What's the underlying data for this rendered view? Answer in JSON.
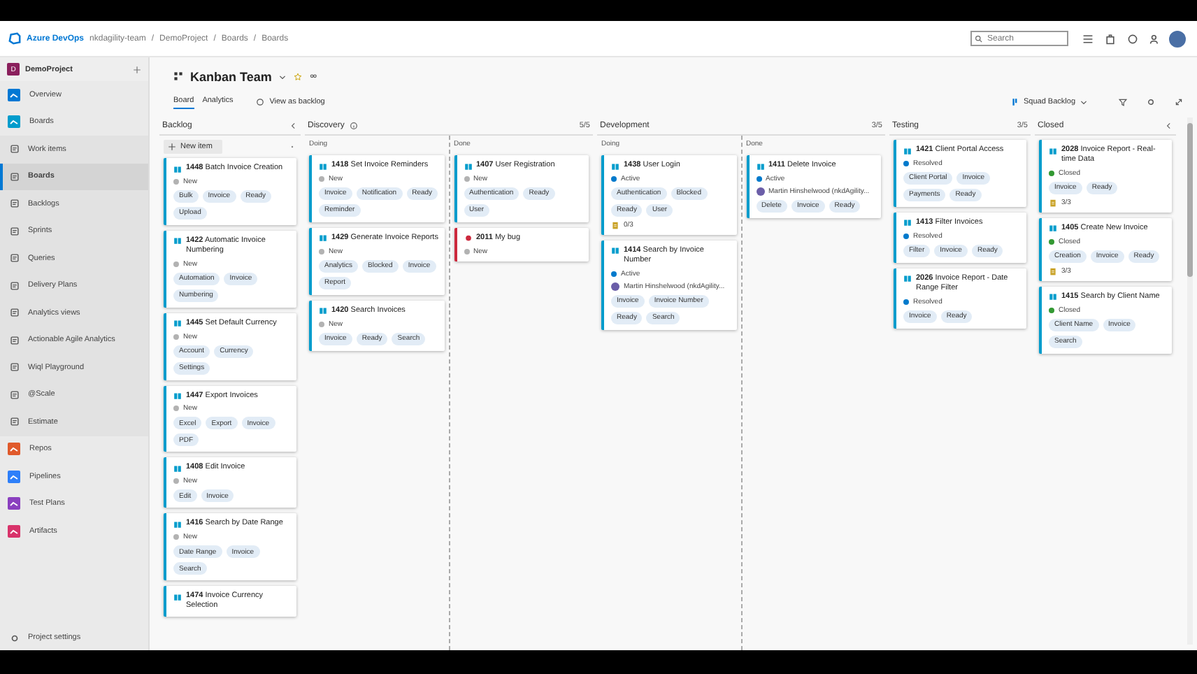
{
  "header": {
    "brand": "Azure DevOps",
    "breadcrumbs": [
      "nkdagility-team",
      "DemoProject",
      "Boards",
      "Boards"
    ],
    "separator": "/",
    "search": {
      "placeholder": "Search"
    }
  },
  "sidebar": {
    "project": {
      "initial": "D",
      "name": "DemoProject"
    },
    "items": [
      {
        "label": "Overview",
        "kind": "service",
        "selected": false
      },
      {
        "label": "Boards",
        "kind": "service",
        "selected": false
      },
      {
        "label": "Work items",
        "kind": "page",
        "selected": false
      },
      {
        "label": "Boards",
        "kind": "page",
        "selected": true
      },
      {
        "label": "Backlogs",
        "kind": "page",
        "selected": false
      },
      {
        "label": "Sprints",
        "kind": "page",
        "selected": false
      },
      {
        "label": "Queries",
        "kind": "page",
        "selected": false
      },
      {
        "label": "Delivery Plans",
        "kind": "page",
        "selected": false
      },
      {
        "label": "Analytics views",
        "kind": "page",
        "selected": false
      },
      {
        "label": "Actionable Agile Analytics",
        "kind": "page",
        "selected": false
      },
      {
        "label": "Wiql Playground",
        "kind": "page",
        "selected": false
      },
      {
        "label": "@Scale",
        "kind": "page",
        "selected": false
      },
      {
        "label": "Estimate",
        "kind": "page",
        "selected": false
      },
      {
        "label": "Repos",
        "kind": "service",
        "selected": false
      },
      {
        "label": "Pipelines",
        "kind": "service",
        "selected": false
      },
      {
        "label": "Test Plans",
        "kind": "service",
        "selected": false
      },
      {
        "label": "Artifacts",
        "kind": "service",
        "selected": false
      }
    ],
    "settings": "Project settings"
  },
  "board_header": {
    "title": "Kanban Team",
    "tabs": [
      {
        "label": "Board",
        "selected": true
      },
      {
        "label": "Analytics",
        "selected": false
      }
    ],
    "view_link": "View as backlog",
    "backlog_picker": "Squad Backlog"
  },
  "columns": [
    {
      "name": "Backlog",
      "collapse": true,
      "new_item": "New item",
      "lanes": [
        {
          "cards": [
            {
              "kind": "story",
              "id": "1448",
              "title": "Batch Invoice Creation",
              "state": "New",
              "color": "#b2b2b2",
              "tags": [
                "Bulk",
                "Invoice",
                "Ready",
                "Upload"
              ]
            },
            {
              "kind": "story",
              "id": "1422",
              "title": "Automatic Invoice Numbering",
              "state": "New",
              "color": "#b2b2b2",
              "tags": [
                "Automation",
                "Invoice",
                "Numbering"
              ]
            },
            {
              "kind": "story",
              "id": "1445",
              "title": "Set Default Currency",
              "state": "New",
              "color": "#b2b2b2",
              "tags": [
                "Account",
                "Currency",
                "Settings"
              ]
            },
            {
              "kind": "story",
              "id": "1447",
              "title": "Export Invoices",
              "state": "New",
              "color": "#b2b2b2",
              "tags": [
                "Excel",
                "Export",
                "Invoice",
                "PDF"
              ]
            },
            {
              "kind": "story",
              "id": "1408",
              "title": "Edit Invoice",
              "state": "New",
              "color": "#b2b2b2",
              "tags": [
                "Edit",
                "Invoice"
              ]
            },
            {
              "kind": "story",
              "id": "1416",
              "title": "Search by Date Range",
              "state": "New",
              "color": "#b2b2b2",
              "tags": [
                "Date Range",
                "Invoice",
                "Search"
              ]
            },
            {
              "kind": "story",
              "id": "1474",
              "title": "Invoice Currency Selection"
            }
          ]
        }
      ]
    },
    {
      "name": "Discovery",
      "count": "5/5",
      "info": true,
      "lanes": [
        {
          "name": "Doing",
          "cards": [
            {
              "kind": "story",
              "id": "1418",
              "title": "Set Invoice Reminders",
              "state": "New",
              "color": "#b2b2b2",
              "tags": [
                "Invoice",
                "Notification",
                "Ready",
                "Reminder"
              ]
            },
            {
              "kind": "story",
              "id": "1429",
              "title": "Generate Invoice Reports",
              "state": "New",
              "color": "#b2b2b2",
              "tags": [
                "Analytics",
                "Blocked",
                "Invoice",
                "Report"
              ]
            },
            {
              "kind": "story",
              "id": "1420",
              "title": "Search Invoices",
              "state": "New",
              "color": "#b2b2b2",
              "tags": [
                "Invoice",
                "Ready",
                "Search"
              ]
            }
          ]
        },
        {
          "name": "Done",
          "cards": [
            {
              "kind": "story",
              "id": "1407",
              "title": "User Registration",
              "state": "New",
              "color": "#b2b2b2",
              "tags": [
                "Authentication",
                "Ready",
                "User"
              ]
            },
            {
              "kind": "bug",
              "id": "2011",
              "title": "My bug",
              "state": "New",
              "color": "#b2b2b2"
            }
          ]
        }
      ]
    },
    {
      "name": "Development",
      "count": "3/5",
      "lanes": [
        {
          "name": "Doing",
          "cards": [
            {
              "kind": "story",
              "id": "1438",
              "title": "User Login",
              "state": "Active",
              "color": "#007acc",
              "tags": [
                "Authentication",
                "Blocked",
                "Ready",
                "User"
              ],
              "tasks": "0/3"
            },
            {
              "kind": "story",
              "id": "1414",
              "title": "Search by Invoice Number",
              "state": "Active",
              "color": "#007acc",
              "assignee": "Martin Hinshelwood (nkdAgility...",
              "tags": [
                "Invoice",
                "Invoice Number",
                "Ready",
                "Search"
              ]
            }
          ]
        },
        {
          "name": "Done",
          "cards": [
            {
              "kind": "story",
              "id": "1411",
              "title": "Delete Invoice",
              "state": "Active",
              "color": "#007acc",
              "assignee": "Martin Hinshelwood (nkdAgility...",
              "tags": [
                "Delete",
                "Invoice",
                "Ready"
              ]
            }
          ]
        }
      ]
    },
    {
      "name": "Testing",
      "count": "3/5",
      "lanes": [
        {
          "cards": [
            {
              "kind": "story",
              "id": "1421",
              "title": "Client Portal Access",
              "state": "Resolved",
              "color": "#007acc",
              "tags": [
                "Client Portal",
                "Invoice",
                "Payments",
                "Ready"
              ]
            },
            {
              "kind": "story",
              "id": "1413",
              "title": "Filter Invoices",
              "state": "Resolved",
              "color": "#007acc",
              "tags": [
                "Filter",
                "Invoice",
                "Ready"
              ]
            },
            {
              "kind": "story",
              "id": "2026",
              "title": "Invoice Report - Date Range Filter",
              "state": "Resolved",
              "color": "#007acc",
              "tags": [
                "Invoice",
                "Ready"
              ]
            }
          ]
        }
      ]
    },
    {
      "name": "Closed",
      "collapse": true,
      "lanes": [
        {
          "cards": [
            {
              "kind": "story",
              "id": "2028",
              "title": "Invoice Report - Real-time Data",
              "state": "Closed",
              "color": "#339933",
              "tags": [
                "Invoice",
                "Ready"
              ],
              "tasks": "3/3"
            },
            {
              "kind": "story",
              "id": "1405",
              "title": "Create New Invoice",
              "state": "Closed",
              "color": "#339933",
              "tags": [
                "Creation",
                "Invoice",
                "Ready"
              ],
              "tasks": "3/3"
            },
            {
              "kind": "story",
              "id": "1415",
              "title": "Search by Client Name",
              "state": "Closed",
              "color": "#339933",
              "tags": [
                "Client Name",
                "Invoice",
                "Search"
              ]
            }
          ]
        }
      ]
    }
  ]
}
